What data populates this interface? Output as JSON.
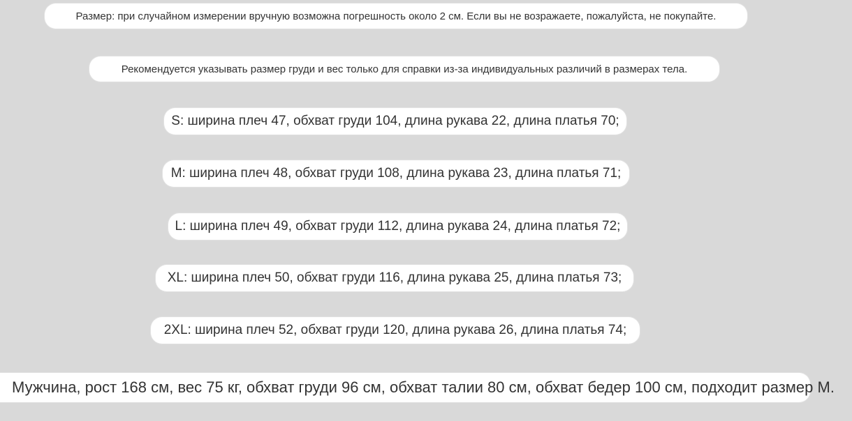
{
  "notice": "Размер: при случайном измерении вручную возможна погрешность около 2 см. Если вы не возражаете, пожалуйста, не покупайте.",
  "recommendation": "Рекомендуется указывать размер груди и вес только для справки из-за индивидуальных различий в размерах тела.",
  "sizes": [
    "S: ширина плеч 47, обхват груди 104, длина рукава 22, длина платья 70;",
    "M: ширина плеч 48, обхват груди 108, длина рукава 23, длина платья 71;",
    "L: ширина плеч 49, обхват груди 112, длина рукава 24, длина платья 72;",
    "XL: ширина плеч 50, обхват груди 116, длина рукава 25, длина платья 73;",
    "2XL: ширина плеч 52, обхват груди 120, длина рукава 26, длина платья 74;"
  ],
  "model_note": "Мужчина, рост 168 см, вес 75 кг, обхват груди 96 см, обхват талии 80 см, обхват бедер 100 см, подходит размер M.",
  "colors": {
    "background": "#d9d9d9",
    "pill": "#ffffff",
    "text": "#333333"
  }
}
